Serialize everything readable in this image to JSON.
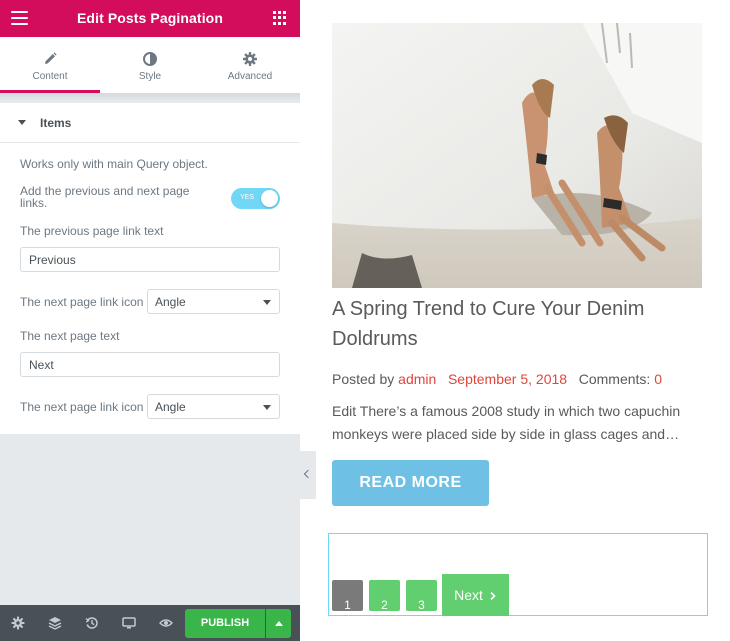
{
  "panel": {
    "title": "Edit Posts Pagination",
    "tabs": [
      {
        "label": "Content",
        "icon": "pencil-icon",
        "active": true
      },
      {
        "label": "Style",
        "icon": "half-circle-icon",
        "active": false
      },
      {
        "label": "Advanced",
        "icon": "gear-icon",
        "active": false
      }
    ],
    "section": {
      "label": "Items",
      "expanded": true
    },
    "controls": {
      "notice": "Works only with main Query object.",
      "prev_next_label_line1": "Add the previous and next page",
      "prev_next_label_line2": "links.",
      "prev_next_switch": "YES",
      "prev_text_label": "The previous page link text",
      "prev_text_value": "Previous",
      "next_icon_label_1": "The next page link icon",
      "next_icon_value_1": "Angle",
      "next_text_label": "The next page text",
      "next_text_value": "Next",
      "next_icon_label_2": "The next page link icon",
      "next_icon_value_2": "Angle"
    },
    "footer": {
      "icons": [
        "settings-icon",
        "layers-icon",
        "history-icon",
        "responsive-icon",
        "preview-eye-icon"
      ],
      "publish_label": "PUBLISH"
    }
  },
  "preview": {
    "post_title": "A Spring Trend to Cure Your Denim Doldrums",
    "meta_prefix": "Posted by",
    "author": "admin",
    "date": "September 5, 2018",
    "comments_label": "Comments:",
    "comments_count": "0",
    "excerpt": "Edit There’s a famous 2008 study in which two capuchin monkeys were placed side by side in glass cages and…",
    "read_more": "READ MORE",
    "pagination": {
      "pages": [
        "1",
        "2",
        "3"
      ],
      "current_page": "1",
      "next_label": "Next"
    }
  },
  "colors": {
    "brand": "#d30c5c",
    "publish": "#39b54a",
    "read_more": "#6ec1e4",
    "page_active": "#7a7a7a",
    "page_link": "#61ce70",
    "accent_meta": "#e0453a"
  }
}
